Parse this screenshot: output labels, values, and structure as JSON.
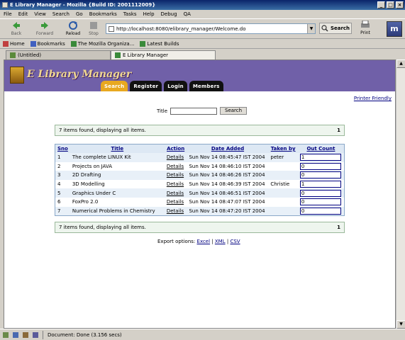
{
  "window": {
    "title": "E Library Manager - Mozilla {Build ID: 2001112009}"
  },
  "menu": [
    "File",
    "Edit",
    "View",
    "Search",
    "Go",
    "Bookmarks",
    "Tasks",
    "Help",
    "Debug",
    "QA"
  ],
  "nav": {
    "back": "Back",
    "forward": "Forward",
    "reload": "Reload",
    "stop": "Stop",
    "url": "http://localhost:8080/elibrary_manager/Welcome.do",
    "search": "Search",
    "print": "Print"
  },
  "personal": {
    "home": "Home",
    "bookmarks": "Bookmarks",
    "mozilla": "The Mozilla Organiza...",
    "builds": "Latest Builds"
  },
  "tabs": [
    "(Untitled)",
    "E Library Manager"
  ],
  "page": {
    "title": "E Library Manager",
    "navtabs": [
      "Search",
      "Register",
      "Login",
      "Members"
    ],
    "printer_friendly": "Printer Friendly",
    "search_label": "Title",
    "search_button": "Search",
    "info_text": "7 items found, displaying all items.",
    "info_page": "1",
    "columns": [
      "Sno",
      "Title",
      "Action",
      "Date Added",
      "Taken by",
      "Out Count"
    ],
    "rows": [
      {
        "sno": "1",
        "title": "The complete LINUX Kit",
        "action": "Details",
        "date": "Sun Nov 14 08:45:47 IST 2004",
        "taken": "peter",
        "count": "1"
      },
      {
        "sno": "2",
        "title": "Projects on JAVA",
        "action": "Details",
        "date": "Sun Nov 14 08:46:10 IST 2004",
        "taken": "",
        "count": "0"
      },
      {
        "sno": "3",
        "title": "2D Drafting",
        "action": "Details",
        "date": "Sun Nov 14 08:46:26 IST 2004",
        "taken": "",
        "count": "0"
      },
      {
        "sno": "4",
        "title": "3D Modelling",
        "action": "Details",
        "date": "Sun Nov 14 08:46:39 IST 2004",
        "taken": "Christie",
        "count": "1"
      },
      {
        "sno": "5",
        "title": "Graphics Under C",
        "action": "Details",
        "date": "Sun Nov 14 08:46:51 IST 2004",
        "taken": "",
        "count": "0"
      },
      {
        "sno": "6",
        "title": "FoxPro 2.0",
        "action": "Details",
        "date": "Sun Nov 14 08:47:07 IST 2004",
        "taken": "",
        "count": "0"
      },
      {
        "sno": "7",
        "title": "Numerical Problems in Chemistry",
        "action": "Details",
        "date": "Sun Nov 14 08:47:20 IST 2004",
        "taken": "",
        "count": "0"
      }
    ],
    "export_label": "Export options:",
    "export_excel": "Excel",
    "export_xml": "XML",
    "export_csv": "CSV",
    "export_sep": "|"
  },
  "status": {
    "text": "Document: Done (3.156 secs)"
  },
  "colors": {
    "banner": "#7060a8",
    "active_tab": "#e8a820",
    "row_alt": "#e8f0f8"
  }
}
